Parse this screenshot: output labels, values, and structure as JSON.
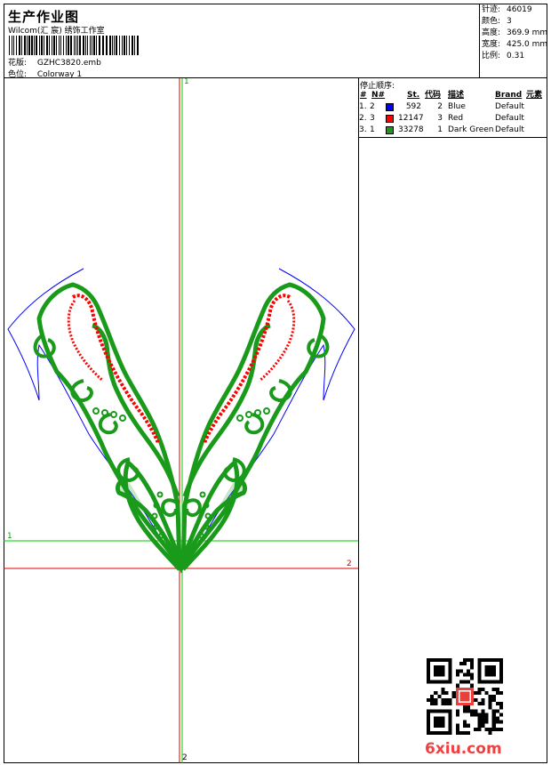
{
  "header": {
    "title": "生产作业图",
    "company": "Wilcom(汇 宸) 绣饰工作室",
    "design_label": "花版:",
    "design_value": "GZHC3820.emb",
    "colorway_label": "色位:",
    "colorway_value": "Colorway 1"
  },
  "stats": [
    {
      "label": "针迹:",
      "value": "46019"
    },
    {
      "label": "颜色:",
      "value": "3"
    },
    {
      "label": "高度:",
      "value": "369.9 mm"
    },
    {
      "label": "宽度:",
      "value": "425.0 mm"
    },
    {
      "label": "比例:",
      "value": "0.31"
    }
  ],
  "sequence": {
    "title": "停止顺序:",
    "columns": [
      "#",
      "N#",
      "St.",
      "代码",
      "描述",
      "Brand",
      "元素"
    ],
    "rows": [
      {
        "index": "1.",
        "n": "2",
        "color": "#0000ff",
        "st": "592",
        "code": "2",
        "desc": "Blue",
        "brand": "Default"
      },
      {
        "index": "2.",
        "n": "3",
        "color": "#ff0000",
        "st": "12147",
        "code": "3",
        "desc": "Red",
        "brand": "Default"
      },
      {
        "index": "3.",
        "n": "1",
        "color": "#1a9a1a",
        "st": "33278",
        "code": "1",
        "desc": "Dark Green",
        "brand": "Default"
      }
    ]
  },
  "axes": {
    "green_label_top": "1",
    "green_label_left": "1",
    "red_label_right": "2",
    "red_label_bottom": "2",
    "green_color": "#00cc00",
    "red_color": "#dd0000"
  },
  "colors": {
    "green": "#1a9a1a",
    "red": "#ff0000",
    "blue": "#0000ff"
  },
  "watermark": "6xiu.com"
}
